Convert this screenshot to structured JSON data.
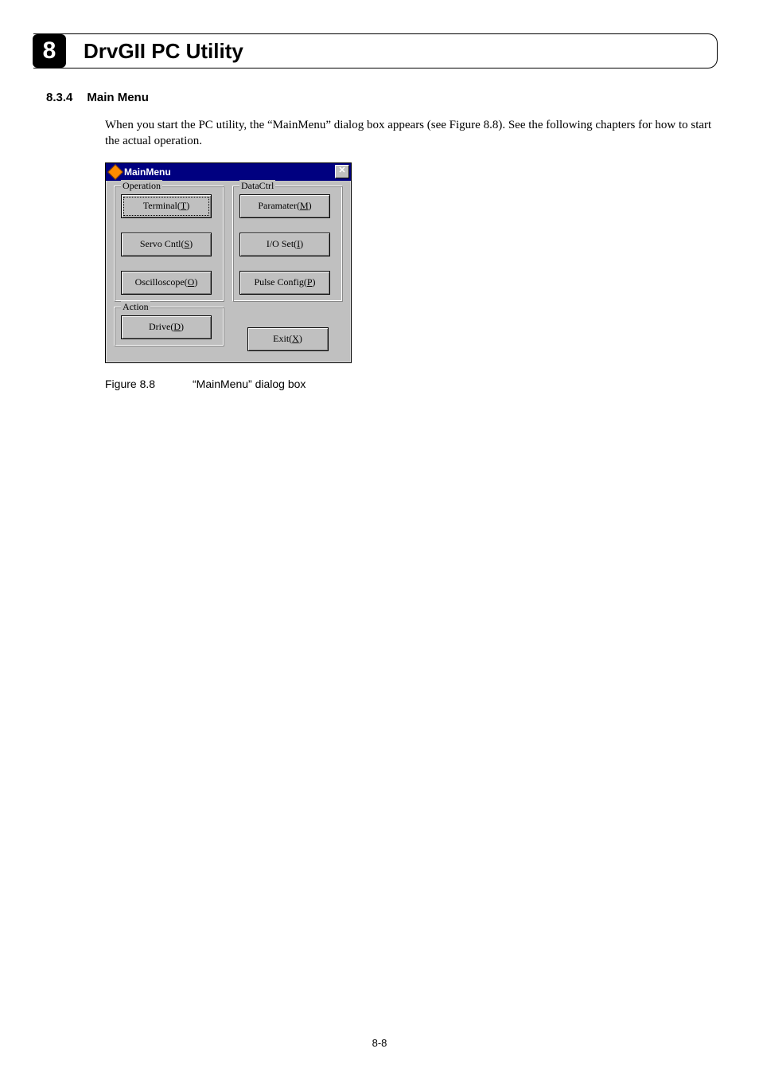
{
  "chapter": {
    "number": "8",
    "title": "DrvGII PC Utility"
  },
  "section": {
    "number": "8.3.4",
    "title": "Main Menu"
  },
  "body_paragraph": "When you start the PC utility, the “MainMenu” dialog box appears (see Figure 8.8). See the following chapters for how to start the actual operation.",
  "dialog": {
    "title": "MainMenu",
    "close_glyph": "✕",
    "groups": {
      "operation": {
        "legend": "Operation",
        "buttons": {
          "terminal": {
            "text": "Terminal(",
            "mnemonic": "T",
            "suffix": ")"
          },
          "servo": {
            "text": "Servo Cntl(",
            "mnemonic": "S",
            "suffix": ")"
          },
          "oscope": {
            "text": "Oscilloscope(",
            "mnemonic": "O",
            "suffix": ")"
          }
        }
      },
      "datactrl": {
        "legend": "DataCtrl",
        "buttons": {
          "parameter": {
            "text": "Paramater(",
            "mnemonic": "M",
            "suffix": ")"
          },
          "ioset": {
            "text": "I/O Set(",
            "mnemonic": "I",
            "suffix": ")"
          },
          "pulse": {
            "text": "Pulse Config(",
            "mnemonic": "P",
            "suffix": ")"
          }
        }
      },
      "action": {
        "legend": "Action",
        "buttons": {
          "drive": {
            "text": "Drive(",
            "mnemonic": "D",
            "suffix": ")"
          }
        }
      }
    },
    "exit": {
      "text": "Exit(",
      "mnemonic": "X",
      "suffix": ")"
    }
  },
  "figure": {
    "label": "Figure 8.8",
    "caption": "“MainMenu” dialog box"
  },
  "page_number": "8-8"
}
